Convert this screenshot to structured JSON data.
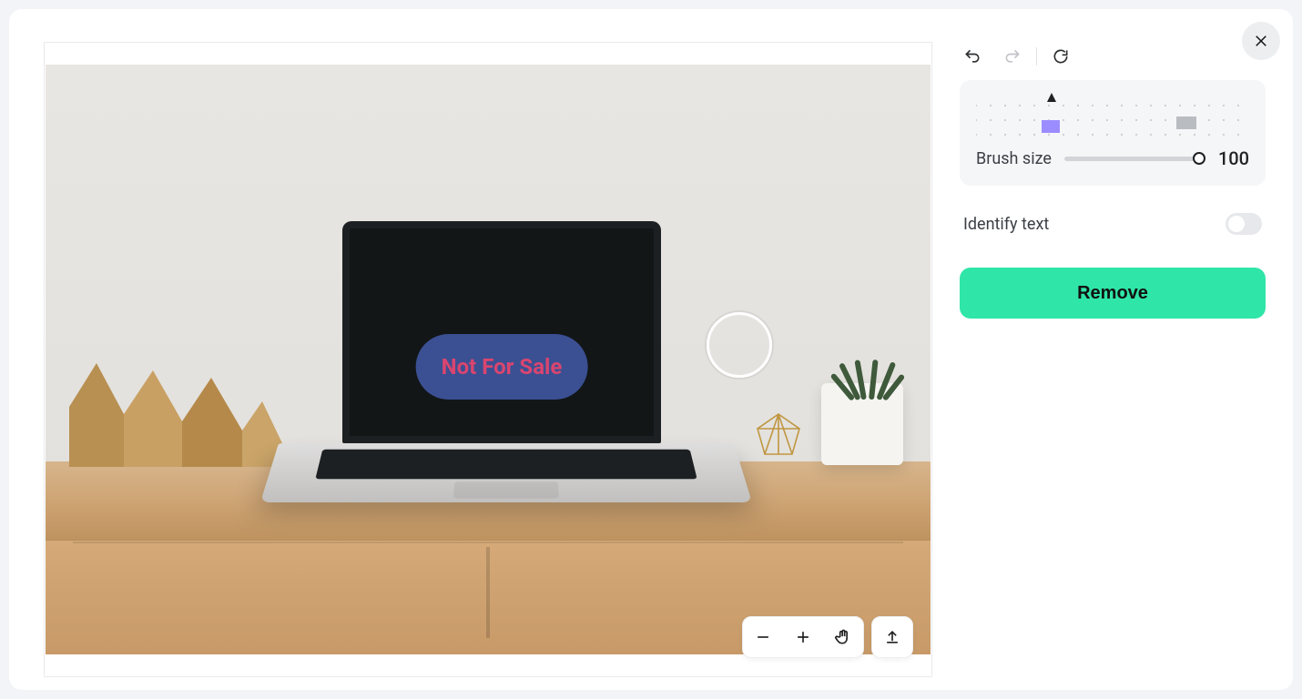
{
  "image": {
    "overlay_text": "Not For Sale"
  },
  "controls": {
    "brush_size_label": "Brush size",
    "brush_size_value": "100",
    "identify_text_label": "Identify text",
    "identify_text_on": false
  },
  "actions": {
    "remove_label": "Remove"
  },
  "colors": {
    "primary_button": "#2fe5a8",
    "selection_fill": "#3b5093",
    "selection_text": "#d9456f"
  }
}
